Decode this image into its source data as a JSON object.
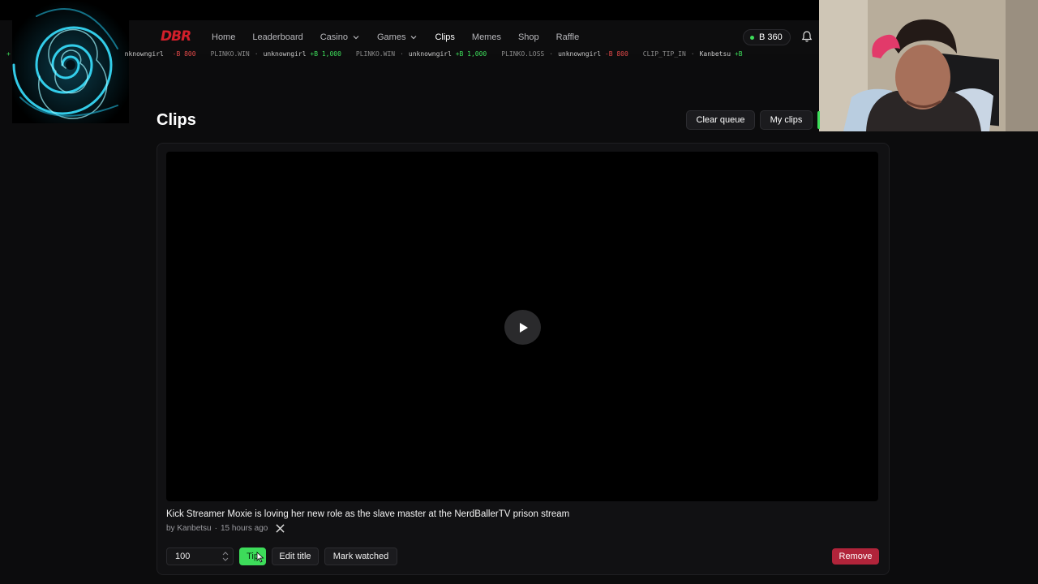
{
  "nav": {
    "logo": "DBR",
    "links": [
      {
        "label": "Home"
      },
      {
        "label": "Leaderboard"
      },
      {
        "label": "Casino"
      },
      {
        "label": "Games"
      },
      {
        "label": "Clips"
      },
      {
        "label": "Memes"
      },
      {
        "label": "Shop"
      },
      {
        "label": "Raffle"
      }
    ],
    "balance": "B 360"
  },
  "ticker": [
    {
      "prefix": "+",
      "user": "nknowngirl",
      "amount": "-B 800",
      "sign": "neg"
    },
    {
      "event": "PLINKO.WIN",
      "user": "unknowngirl",
      "amount": "+B 1,000",
      "sign": "pos"
    },
    {
      "event": "PLINKO.WIN",
      "user": "unknowngirl",
      "amount": "+B 1,000",
      "sign": "pos"
    },
    {
      "event": "PLINKO.LOSS",
      "user": "unknowngirl",
      "amount": "-B 800",
      "sign": "neg"
    },
    {
      "event": "CLIP_TIP_IN",
      "user": "Kanbetsu",
      "amount": "+B",
      "sign": "pos"
    }
  ],
  "page": {
    "title": "Clips",
    "clear_queue": "Clear queue",
    "my_clips": "My clips"
  },
  "clip": {
    "title": "Kick Streamer Moxie is loving her new role as the slave master at the NerdBallerTV prison stream",
    "author": "by Kanbetsu",
    "time": "15 hours ago",
    "tip_amount": "100",
    "tip_label": "Tip",
    "edit_title": "Edit title",
    "mark_watched": "Mark watched",
    "remove": "Remove"
  },
  "colors": {
    "accent_green": "#3ddc5a",
    "danger_red": "#b1243a",
    "logo_red": "#d21f2a"
  }
}
